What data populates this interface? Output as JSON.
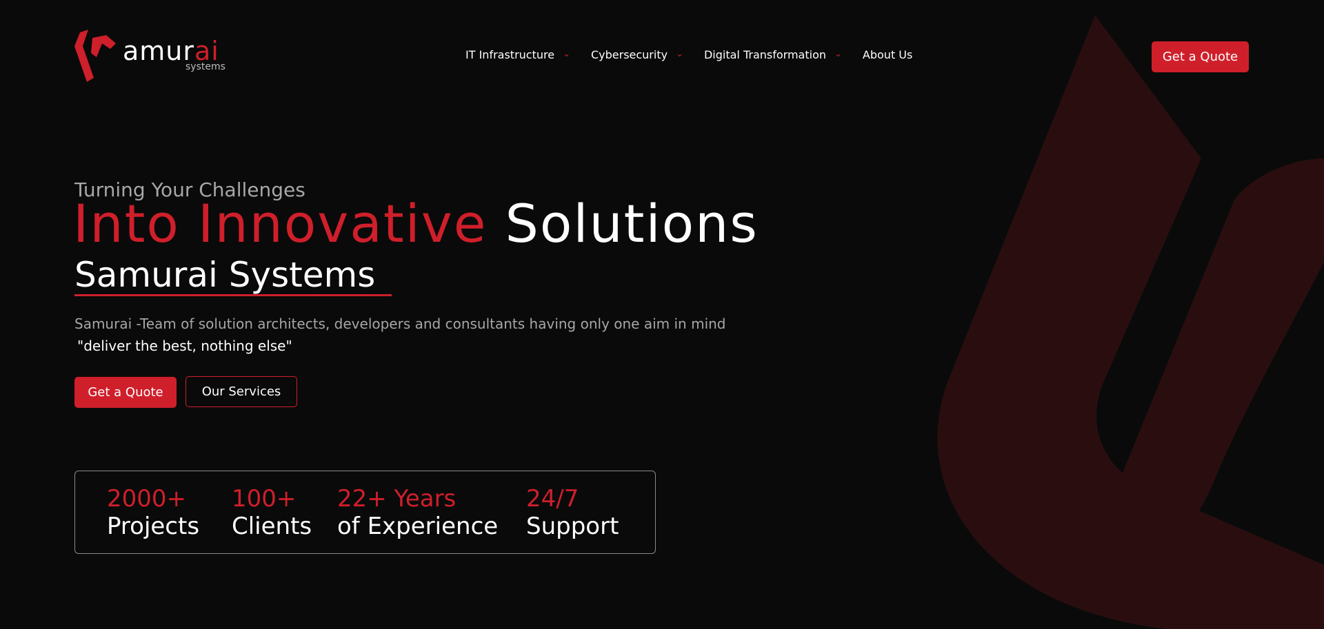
{
  "colors": {
    "accent": "#cf1f2b",
    "background": "#0a0a0a",
    "muted_text": "#a7a7a7",
    "bg_shape": "#2a0e0f"
  },
  "logo": {
    "prefix": "amur",
    "accent": "ai",
    "tagline": "systems"
  },
  "nav": {
    "items": [
      {
        "label": "IT Infrastructure",
        "has_dropdown": true,
        "icon": "chevron-down-icon"
      },
      {
        "label": "Cybersecurity",
        "has_dropdown": true,
        "icon": "chevron-down-icon"
      },
      {
        "label": "Digital Transformation",
        "has_dropdown": true,
        "icon": "chevron-down-icon"
      },
      {
        "label": "About Us",
        "has_dropdown": false
      }
    ],
    "cta_label": "Get a Quote"
  },
  "hero": {
    "pre_title": "Turning Your Challenges",
    "headline_accent": "Into Innovative",
    "headline_rest": "Solutions",
    "brand": "Samurai Systems",
    "description": "Samurai -Team of solution architects, developers and consultants having only one aim in mind",
    "quote": "\"deliver the best, nothing else\"",
    "primary_button": "Get a Quote",
    "secondary_button": "Our Services"
  },
  "stats": [
    {
      "value": "2000+",
      "label": "Projects"
    },
    {
      "value": "100+",
      "label": "Clients"
    },
    {
      "value": "22+ Years",
      "label": "of Experience"
    },
    {
      "value": "24/7",
      "label": "Support"
    }
  ]
}
